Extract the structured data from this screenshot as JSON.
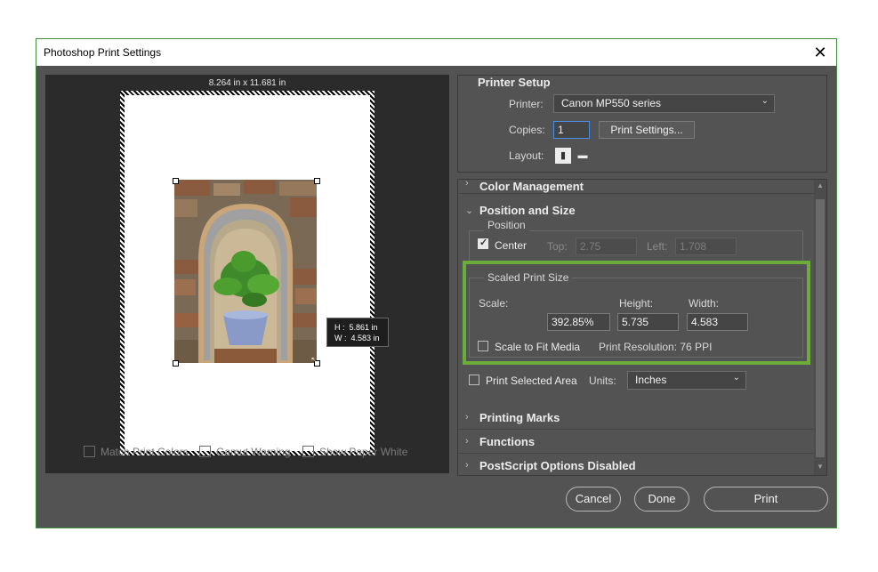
{
  "window": {
    "title": "Photoshop Print Settings",
    "close_glyph": "✕"
  },
  "preview": {
    "paper_size": "8.264 in x 11.681 in",
    "tooltip_h_label": "H :",
    "tooltip_h_value": "5.861 in",
    "tooltip_w_label": "W :",
    "tooltip_w_value": "4.583 in",
    "resize_icon": "resize-icon"
  },
  "preview_options": {
    "match_print_colors": "Match Print Colors",
    "gamut_warning": "Gamut Warning",
    "show_paper_white": "Show Paper White"
  },
  "printer_setup": {
    "heading": "Printer Setup",
    "printer_label": "Printer:",
    "printer_value": "Canon MP550 series",
    "copies_label": "Copies:",
    "copies_value": "1",
    "print_settings_button": "Print Settings...",
    "layout_label": "Layout:",
    "layout_icons": [
      "portrait-icon",
      "landscape-icon"
    ]
  },
  "sections": {
    "color_management": "Color Management",
    "position_and_size": "Position and Size",
    "printing_marks": "Printing Marks",
    "functions": "Functions",
    "postscript": "PostScript Options Disabled"
  },
  "position": {
    "group_title": "Position",
    "center_label": "Center",
    "center_checked": true,
    "top_label": "Top:",
    "top_value": "2.75",
    "left_label": "Left:",
    "left_value": "1.708"
  },
  "scaled_print_size": {
    "group_title": "Scaled Print Size",
    "scale_label": "Scale:",
    "scale_value": "392.85%",
    "height_label": "Height:",
    "height_value": "5.735",
    "width_label": "Width:",
    "width_value": "4.583",
    "scale_to_fit_label": "Scale to Fit Media",
    "scale_to_fit_checked": false,
    "print_resolution": "Print Resolution: 76 PPI"
  },
  "print_selected": {
    "label": "Print Selected Area",
    "checked": false,
    "units_label": "Units:",
    "units_value": "Inches"
  },
  "buttons": {
    "cancel": "Cancel",
    "done": "Done",
    "print": "Print"
  },
  "colors": {
    "dialog_bg": "#535353",
    "highlight": "#6cad3a",
    "preview_bg": "#2b2b2b"
  }
}
